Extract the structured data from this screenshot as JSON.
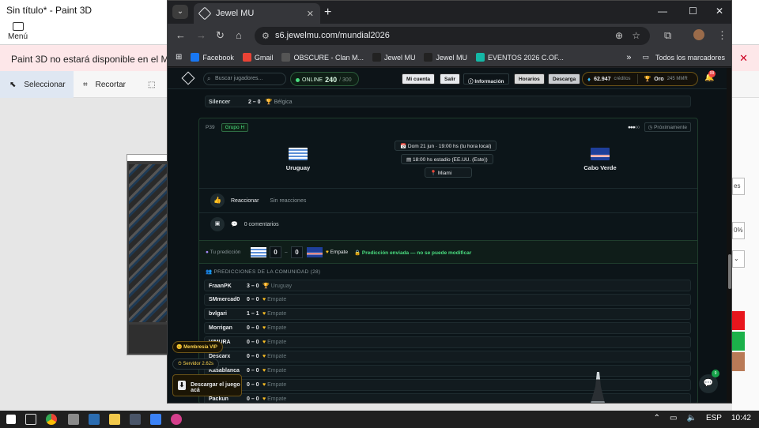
{
  "paint3d": {
    "title": "Sin título* - Paint 3D",
    "menu_label": "Menú",
    "banner_text": "Paint 3D no estará disponible en el Microsoft",
    "tools": [
      "Seleccionar",
      "Recortar"
    ],
    "right_items": [
      "es",
      "0%"
    ],
    "swatches": [
      "#e8161d",
      "#1bb14a",
      "#b97a57"
    ]
  },
  "taskbar": {
    "lang": "ESP",
    "time": "10:42"
  },
  "browser": {
    "tab_title": "Jewel MU",
    "url": "s6.jewelmu.com/mundial2026",
    "bookmarks": [
      {
        "label": "Facebook",
        "icon": "facebook-icon",
        "color": "#1877f2"
      },
      {
        "label": "Gmail",
        "icon": "gmail-icon",
        "color": "#ea4335"
      },
      {
        "label": "OBSCURE - Clan M...",
        "icon": "obscure-icon",
        "color": "#555555"
      },
      {
        "label": "Jewel MU",
        "icon": "jewel-icon",
        "color": "#222222"
      },
      {
        "label": "Jewel MU",
        "icon": "jewel-icon",
        "color": "#222222"
      },
      {
        "label": "EVENTOS 2026 C.OF...",
        "icon": "eventos-icon",
        "color": "#14b8a6"
      }
    ],
    "all_bookmarks": "Todos los marcadores",
    "overflow": "»"
  },
  "site": {
    "search_placeholder": "Buscar jugadores...",
    "online_label": "ONLINE",
    "online_count": "240",
    "online_max": "/ 300",
    "nav": [
      "Mi cuenta",
      "Salir",
      "Información",
      "Horarios",
      "Descarga"
    ],
    "credits_value": "62.947",
    "credits_label": "créditos",
    "tier_label": "Oro",
    "tier_mmr": "245 MMR",
    "notif_count": "99"
  },
  "prev_match": {
    "player": "Silencer",
    "score": "2 – 0",
    "winner": "Bélgica"
  },
  "match": {
    "id": "P39",
    "group": "Grupo H",
    "status": "Próximamente",
    "status_dots": "●●●○○",
    "home": "Uruguay",
    "away": "Cabo Verde",
    "date": "Dom 21 jun · 19:00 hs (tu hora local)",
    "stadium_time": "18:00 hs estadio (EE.UU. (Este))",
    "city": "Miami",
    "react_label": "Reaccionar",
    "react_sub": "Sin reacciones",
    "comments_label": "0 comentarios",
    "prediction_label": "Tu predicción",
    "pred_home": "0",
    "pred_away": "0",
    "pred_result": "Empate",
    "pred_sent": "Predicción enviada — no se puede modificar"
  },
  "community": {
    "title": "PREDICCIONES DE LA COMUNIDAD (28)",
    "rows": [
      {
        "name": "FraanPK",
        "score": "3 – 0",
        "outcome": "Uruguay"
      },
      {
        "name": "SMmercad0",
        "score": "0 – 0",
        "outcome": "Empate"
      },
      {
        "name": "bvlgari",
        "score": "1 – 1",
        "outcome": "Empate"
      },
      {
        "name": "Morrigan",
        "score": "0 – 0",
        "outcome": "Empate"
      },
      {
        "name": "VIMURA",
        "score": "0 – 0",
        "outcome": "Empate"
      },
      {
        "name": "Descarx",
        "score": "0 – 0",
        "outcome": "Empate"
      },
      {
        "name": "Kasablanca",
        "score": "0 – 0",
        "outcome": "Empate"
      },
      {
        "name": "",
        "score": "0 – 0",
        "outcome": "Empate"
      },
      {
        "name": "Packun",
        "score": "0 – 0",
        "outcome": "Empate"
      }
    ]
  },
  "floating": {
    "vip": "Membresía VIP",
    "server": "Servidor 2.62s",
    "download": "Descargar el juego acá",
    "chat_badge": "9"
  }
}
